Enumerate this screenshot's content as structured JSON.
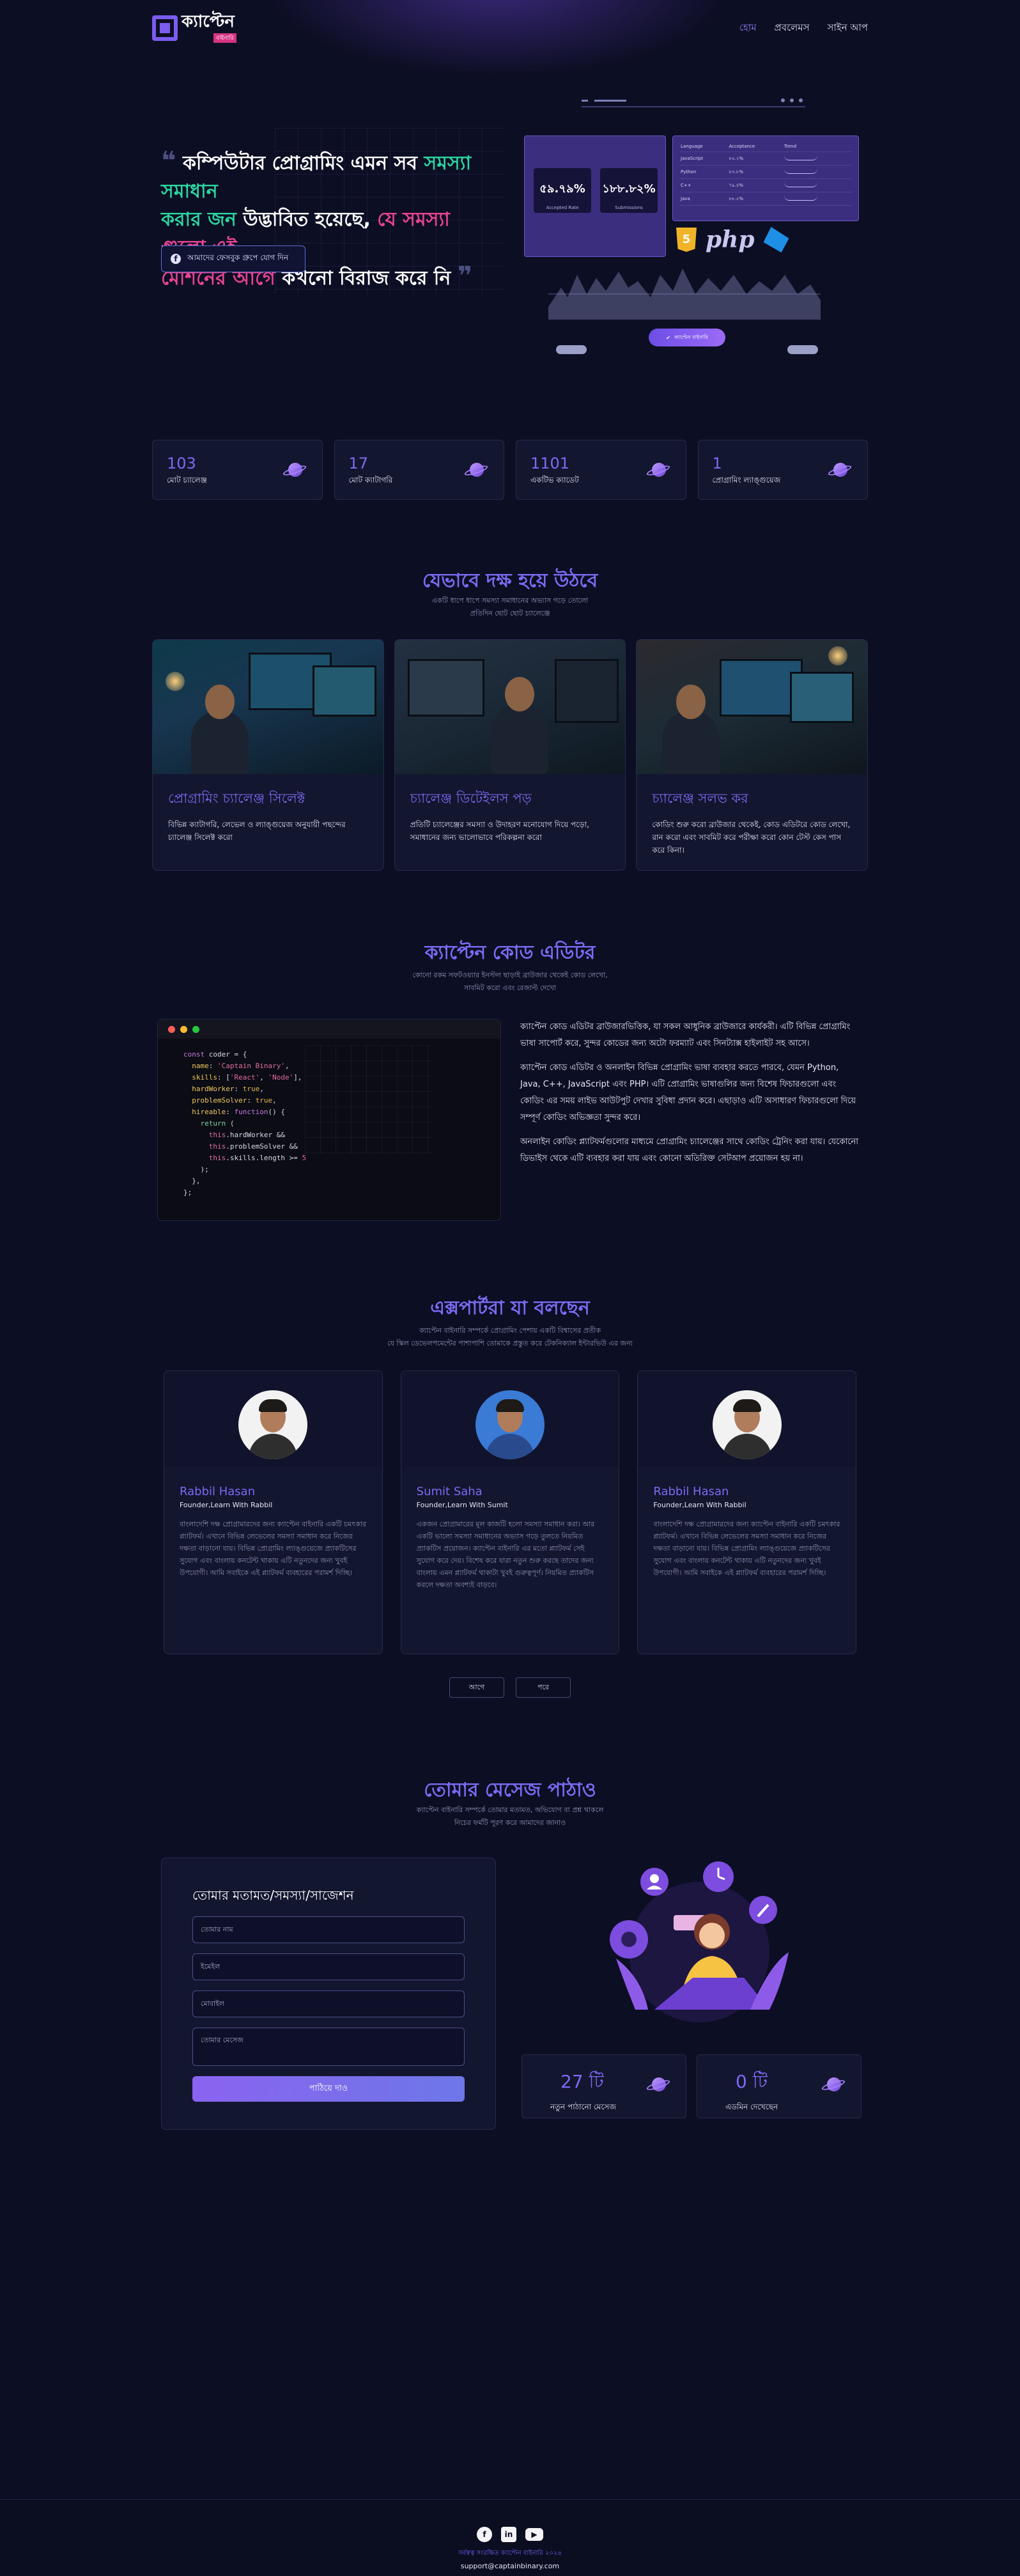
{
  "brand": {
    "name": "ক্যাপ্টেন",
    "tag": "বাইনারি"
  },
  "nav": {
    "items": [
      "হোম",
      "প্রবলেমস",
      "সাইন আপ"
    ]
  },
  "hero": {
    "line1a": "কম্পিউটার প্রোগ্রামিং এমন সব ",
    "line1b": "সমস্যা সমাধান",
    "line2a": "করার জন",
    "line2b": " উদ্ভাবিত হয়েছে, ",
    "line2c": "যে সমস্যা গুলো এই",
    "line3a": "মেশিনের আগে",
    "line3b": " কখনো বিরাজ করে নি",
    "fb_button": "আমাদের ফেসবুক গ্রুপে যোগ দিন"
  },
  "illustration": {
    "stat1": "৫৯.৭৯%",
    "stat1_label": "Accepted Rate",
    "stat2": "১৮৮.৮২%",
    "stat2_label": "Submissions",
    "table_headers": [
      "Language",
      "Acceptance",
      "Trend"
    ],
    "table_rows": [
      [
        "JavaScript",
        "৮৫.২%"
      ],
      [
        "Python",
        "৮৩.৮%"
      ],
      [
        "C++",
        "৭৯.৪%"
      ],
      [
        "Java",
        "৮৮.৫%"
      ]
    ],
    "tech_php": "php",
    "pill": "ক্যাপ্টেন বাইনারি"
  },
  "stats": [
    {
      "num": "103",
      "label": "মোট চ্যালেঞ্জ"
    },
    {
      "num": "17",
      "label": "মোট ক্যাটাগরি"
    },
    {
      "num": "1101",
      "label": "একটিভ ক্যাডেট"
    },
    {
      "num": "1",
      "label": "প্রোগ্রামিং ল্যাঙ্গুয়েজ"
    }
  ],
  "journey": {
    "title": "যেভাবে দক্ষ হয়ে উঠবে",
    "sub1": "একটি ধাপে ধাপে সমস্যা সমাধানের অভ্যাস গড়ে তোলো",
    "sub2": "প্রতিদিন ছোট ছোট চ্যালেঞ্জে",
    "cards": [
      {
        "title": "প্রোগ্রামিং চ্যালেঞ্জ সিলেক্ট",
        "text": "বিভিন্ন ক্যাটাগরি, লেভেল ও ল্যাঙ্গুয়েজ অনুযায়ী পছন্দের চ্যালেঞ্জ সিলেক্ট করো"
      },
      {
        "title": "চ্যালেঞ্জ ডিটেইলস পড়",
        "text": "প্রতিটি চ্যালেঞ্জের সমস্যা ও উদাহরণ মনোযোগ দিয়ে পড়ো, সমাধানের জন্য ভালোভাবে পরিকল্পনা করো"
      },
      {
        "title": "চ্যালেঞ্জ সলভ কর",
        "text": "কোডিং শুরু করো ব্রাউজার থেকেই, কোড এডিটরে কোড লেখো, রান করো এবং সাবমিট করে পরীক্ষা করো কোন টেস্ট কেস পাস করে কিনা।"
      }
    ]
  },
  "editor": {
    "title": "ক্যাপ্টেন কোড এডিটর",
    "sub1": "কোনো রকম সফটওয়্যার ইনস্টল ছাড়াই ব্রাউজার থেকেই কোড লেখো,",
    "sub2": "সাবমিট করো এবং রেজাল্ট দেখো",
    "code": [
      "const coder = {",
      "  name: 'Captain Binary',",
      "  skills: ['React', 'Node'],",
      "  hardWorker: true,",
      "  problemSolver: true,",
      "  hireable: function() {",
      "    return (",
      "      this.hardWorker &&",
      "      this.problemSolver &&",
      "      this.skills.length >= 5",
      "    );",
      "  },",
      "};"
    ],
    "para1": "ক্যাপ্টেন কোড এডিটর ব্রাউজারভিত্তিক, যা সকল আধুনিক ব্রাউজারে কার্যকরী। এটি বিভিন্ন প্রোগ্রামিং ভাষা সাপোর্ট করে, সুন্দর কোডের জন্য অটো ফরম্যাট এবং সিনট্যাক্স হাইলাইট সহ আসে।",
    "para2": "ক্যাপ্টেন কোড এডিটর ও অনলাইন বিভিন্ন প্রোগ্রামিং ভাষা ব্যবহার করতে পারবে, যেমন Python, Java, C++, JavaScript এবং PHP। এটি প্রোগ্রামিং ভাষাগুলির জন্য বিশেষ ফিচারগুলো এবং কোডিং এর সময় লাইভ আউটপুট দেখার সুবিধা প্রদান করে। এছাড়াও এটি অসাধারণ ফিচারগুলো দিয়ে সম্পূর্ণ কোডিং অভিজ্ঞতা সুন্দর করে।",
    "para3": "অনলাইন কোডিং প্ল্যাটফর্মগুলোর মাধ্যমে প্রোগ্রামিং চ্যালেঞ্জের সাথে কোডিং ট্রেনিং করা যায়। যেকোনো ডিভাইস থেকে এটি ব্যবহার করা যায় এবং কোনো অতিরিক্ত সেটআপ প্রয়োজন হয় না।"
  },
  "testimonials": {
    "title": "এক্সপার্টরা যা বলছেন",
    "sub1": "ক্যাপ্টেন বাইনারি সম্পর্কে প্রোগ্রামিং পেশায় একটি বিশ্বাসের প্রতীক",
    "sub2": "যে স্কিল ডেভেলপমেন্টের পাশাপাশি তোমাকে প্রস্তুত করে টেকনিক্যাল ইন্টারভিউ এর জন্য",
    "items": [
      {
        "name": "Rabbil Hasan",
        "role": "Founder,Learn With Rabbil",
        "text": "বাংলাদেশি দক্ষ প্রোগ্রামারদের জন্য ক্যাপ্টেন বাইনারি একটি চমৎকার প্ল্যাটফর্ম। এখানে বিভিন্ন লেভেলের সমস্যা সমাধান করে নিজের দক্ষতা বাড়ানো যায়। বিভিন্ন প্রোগ্রামিং ল্যাঙ্গুয়েজে প্র্যাকটিসের সুযোগ এবং বাংলায় কনটেন্ট থাকায় এটি নতুনদের জন্য খুবই উপযোগী। আমি সবাইকে এই প্ল্যাটফর্ম ব্যবহারের পরামর্শ দিচ্ছি।"
      },
      {
        "name": "Sumit Saha",
        "role": "Founder,Learn With Sumit",
        "text": "একজন প্রোগ্রামারের মূল কাজটি হলো সমস্যা সমাধান করা। আর একটি ভালো সমস্যা সমাধানের অভ্যাস গড়ে তুলতে নিয়মিত প্র্যাকটিস প্রয়োজন। ক্যাপ্টেন বাইনারি এর মতো প্ল্যাটফর্ম সেই সুযোগ করে দেয়। বিশেষ করে যারা নতুন শুরু করছে তাদের জন্য বাংলায় এমন প্ল্যাটফর্ম থাকাটা খুবই গুরুত্বপূর্ণ। নিয়মিত প্র্যাকটিস করলে দক্ষতা অবশ্যই বাড়বে।"
      },
      {
        "name": "Rabbil Hasan",
        "role": "Founder,Learn With Rabbil",
        "text": "বাংলাদেশি দক্ষ প্রোগ্রামারদের জন্য ক্যাপ্টেন বাইনারি একটি চমৎকার প্ল্যাটফর্ম। এখানে বিভিন্ন লেভেলের সমস্যা সমাধান করে নিজের দক্ষতা বাড়ানো যায়। বিভিন্ন প্রোগ্রামিং ল্যাঙ্গুয়েজে প্র্যাকটিসের সুযোগ এবং বাংলায় কনটেন্ট থাকায় এটি নতুনদের জন্য খুবই উপযোগী। আমি সবাইকে এই প্ল্যাটফর্ম ব্যবহারের পরামর্শ দিচ্ছি।"
      }
    ],
    "prev": "আগে",
    "next": "পরে"
  },
  "contact": {
    "title": "তোমার মেসেজ পাঠাও",
    "sub1": "ক্যাপ্টেন বাইনারি সম্পর্কে তোমার মতামত, অভিযোগ বা প্রশ্ন থাকলে",
    "sub2": "নিচের ফর্মটি পূরণ করে আমাদের জানাও",
    "form_title": "তোমার মতামত/সমস্যা/সাজেশন",
    "name_placeholder": "তোমার নাম",
    "email_placeholder": "ইমেইল",
    "phone_placeholder": "মোবাইল",
    "message_placeholder": "তোমার মেসেজ",
    "send": "পাঠিয়ে দাও",
    "stats": [
      {
        "num": "27 টি",
        "label": "নতুন পাঠানো মেসেজ"
      },
      {
        "num": "0 টি",
        "label": "এডমিন দেখেছেন"
      }
    ]
  },
  "footer": {
    "copyright": "সর্বস্বত্ব সংরক্ষিত ক্যাপ্টেন বাইনারি ২০২৪",
    "email": "support@captainbinary.com"
  }
}
